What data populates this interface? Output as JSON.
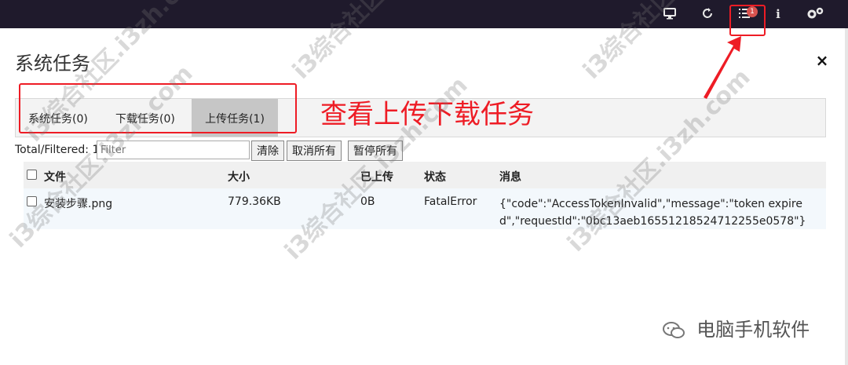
{
  "topbar": {
    "icons": [
      "monitor-icon",
      "refresh-icon",
      "task-list-icon",
      "info-icon",
      "settings-icon"
    ],
    "task_badge": "1",
    "info_glyph": "i"
  },
  "modal": {
    "title": "系统任务",
    "close_label": "×",
    "tabs": [
      {
        "label": "系统任务(0)"
      },
      {
        "label": "下载任务(0)"
      },
      {
        "label": "上传任务(1)",
        "active": true
      }
    ],
    "filter": {
      "label": "Total/Filtered: 1",
      "placeholder": "Filter"
    },
    "buttons": {
      "clear": "清除",
      "cancel_all": "取消所有",
      "pause_all": "暂停所有"
    },
    "table": {
      "headers": [
        "文件",
        "大小",
        "已上传",
        "状态",
        "消息"
      ],
      "rows": [
        {
          "file": "安装步骤.png",
          "size": "779.36KB",
          "uploaded": "0B",
          "status": "FatalError",
          "message": "{\"code\":\"AccessTokenInvalid\",\"message\":\"token expired\",\"requestId\":\"0bc13aeb16551218524712255e0578\"}"
        }
      ]
    }
  },
  "annotation": {
    "text": "查看上传下载任务",
    "color": "#ee1c25"
  },
  "footer": {
    "brand": "电脑手机软件"
  },
  "watermark": {
    "text": "i3综合社区.i3zh.com"
  },
  "colors": {
    "topbar_bg": "#1f1a2c",
    "accent_red": "#ee1c25",
    "active_tab": "#c6c6c6"
  }
}
